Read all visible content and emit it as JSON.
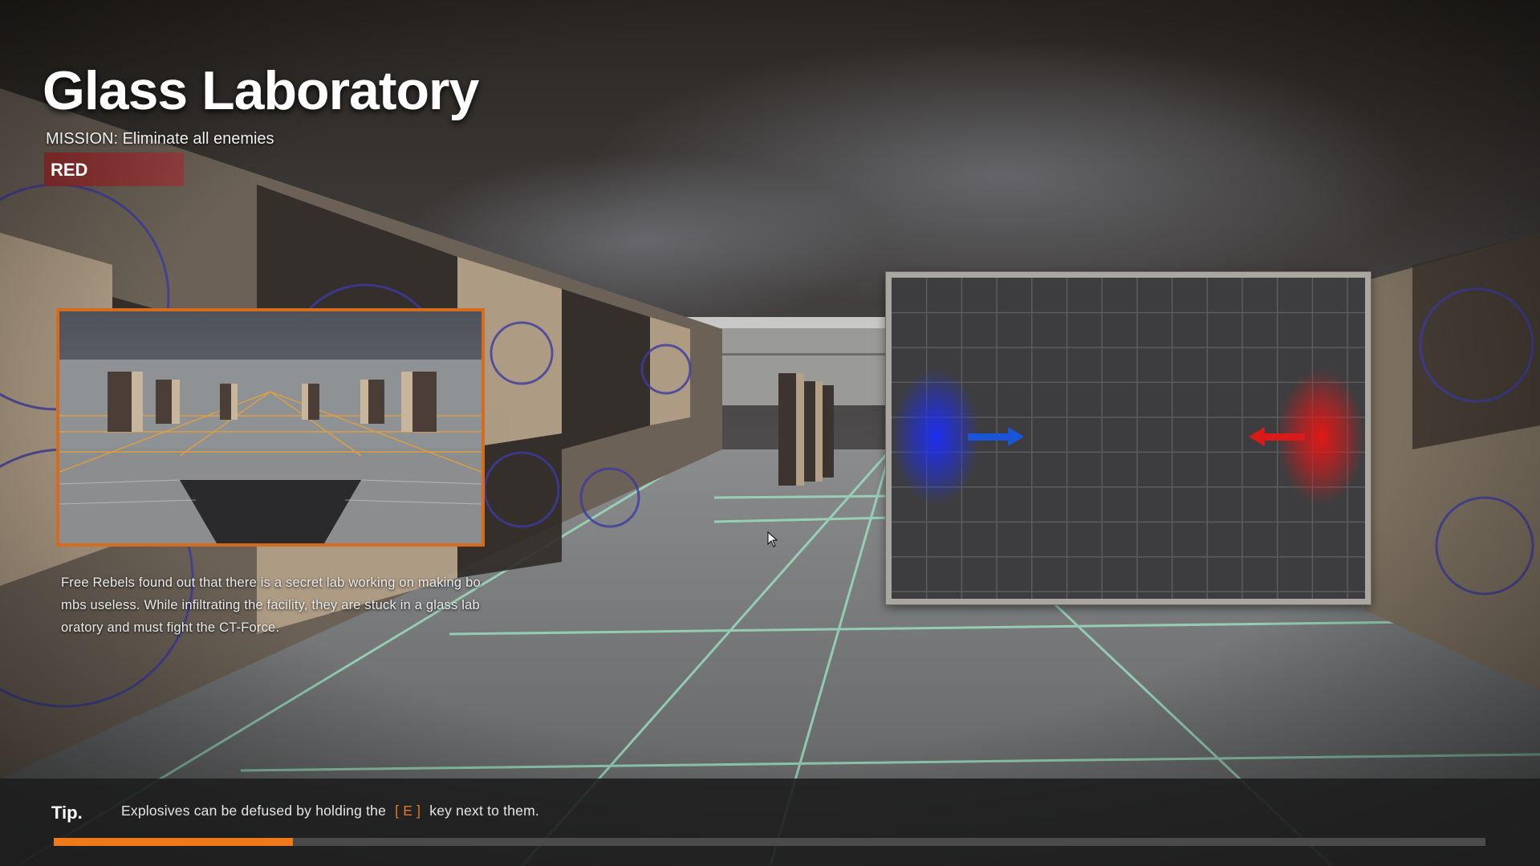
{
  "map": {
    "title": "Glass Laboratory",
    "mission": "MISSION: Eliminate all enemies",
    "team": "RED",
    "description": "Free Rebels found out that there is a secret lab working on making bombs useless. While infiltrating the facility, they are stuck in a glass laboratory and must fight the CT-Force."
  },
  "overview": {
    "spawns": [
      {
        "team": "blue",
        "color": "#1e2ef0",
        "arrow": "right-arrow"
      },
      {
        "team": "red",
        "color": "#e01818",
        "arrow": "left-arrow"
      }
    ]
  },
  "tip": {
    "heading": "Tip.",
    "text_before": "Explosives can be defused by holding the",
    "key": "[ E ]",
    "text_after": "key next to them."
  },
  "loading": {
    "progress": 0.167,
    "accent": "#f07a1a"
  },
  "icons": {
    "cursor": "mouse-cursor-icon"
  }
}
